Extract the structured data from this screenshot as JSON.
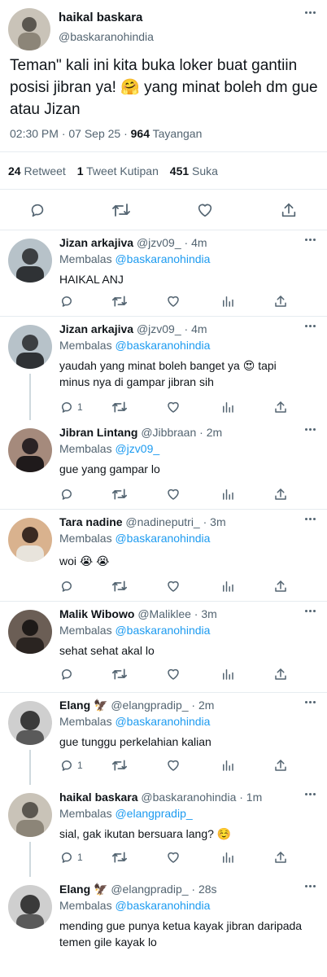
{
  "main_tweet": {
    "name": "haikal baskara",
    "handle": "@baskaranohindia",
    "text": "Teman\" kali ini kita buka loker buat gantiin posisi jibran ya! 🤗  yang minat boleh dm gue atau Jizan",
    "time": "02:30 PM · 07 Sep 25 · ",
    "views_count": "964",
    "views_label": " Tayangan",
    "retweets_count": "24",
    "retweets_label": " Retweet",
    "quotes_count": "1",
    "quotes_label": " Tweet Kutipan",
    "likes_count": "451",
    "likes_label": " Suka",
    "avatar_colors": [
      "#c9c3b8",
      "#5b5750"
    ]
  },
  "replies": [
    {
      "name": "Jizan arkajiva",
      "meta": " @jzv09_ · 4m",
      "replying_label": "Membalas ",
      "replying_to": "@baskaranohindia",
      "text": "HAIKAL ANJ",
      "reply_count": "",
      "avatar_colors": [
        "#b7c2c9",
        "#3c3f42"
      ]
    },
    {
      "name": "Jizan arkajiva",
      "meta": " @jzv09_ · 4m",
      "replying_label": "Membalas ",
      "replying_to": "@baskaranohindia",
      "text": "yaudah yang minat boleh banget ya 😍  tapi minus nya di gampar jibran sih",
      "reply_count": "1",
      "avatar_colors": [
        "#b7c2c9",
        "#3c3f42"
      ]
    },
    {
      "name": "Jibran Lintang",
      "meta": " @Jibbraan · 2m",
      "replying_label": "Membalas ",
      "replying_to": "@jzv09_",
      "text": "gue yang gampar lo",
      "reply_count": "",
      "avatar_colors": [
        "#a58a7c",
        "#2b2325"
      ]
    },
    {
      "name": "Tara nadine",
      "meta": " @nadineputri_ · 3m",
      "replying_label": "Membalas ",
      "replying_to": "@baskaranohindia",
      "text": "woi 😭 😭",
      "reply_count": "",
      "avatar_colors": [
        "#d9b28e",
        "#3a2a22"
      ]
    },
    {
      "name": "Malik Wibowo",
      "meta": " @Maliklee · 3m",
      "replying_label": "Membalas ",
      "replying_to": "@baskaranohindia",
      "text": "sehat sehat akal lo",
      "reply_count": "",
      "avatar_colors": [
        "#6b5e55",
        "#1e1a18"
      ]
    },
    {
      "name": "Elang 🦅",
      "meta": " @elangpradip_ · 2m",
      "replying_label": "Membalas ",
      "replying_to": "@baskaranohindia",
      "text": "gue tunggu perkelahian kalian",
      "reply_count": "1",
      "avatar_colors": [
        "#cfcfcf",
        "#3a3a3a"
      ]
    },
    {
      "name": "haikal baskara",
      "meta": " @baskaranohindia · 1m",
      "replying_label": "Membalas ",
      "replying_to": "@elangpradip_",
      "text": "sial, gak ikutan bersuara lang? ☺️",
      "reply_count": "1",
      "avatar_colors": [
        "#c9c3b8",
        "#5b5750"
      ]
    },
    {
      "name": "Elang 🦅",
      "meta": " @elangpradip_ · 28s",
      "replying_label": "Membalas ",
      "replying_to": "@baskaranohindia",
      "text": "mending gue punya ketua kayak jibran daripada temen gile kayak lo",
      "reply_count": "",
      "avatar_colors": [
        "#cfcfcf",
        "#3a3a3a"
      ]
    }
  ],
  "icons": {
    "reply": "reply-icon",
    "retweet": "retweet-icon",
    "like": "heart-icon",
    "views": "views-icon",
    "share": "share-icon",
    "more": "more-icon"
  },
  "colors": {
    "accent": "#1d9bf0",
    "text": "#0f1419",
    "secondary": "#536471",
    "divider": "#e6ecf0"
  }
}
